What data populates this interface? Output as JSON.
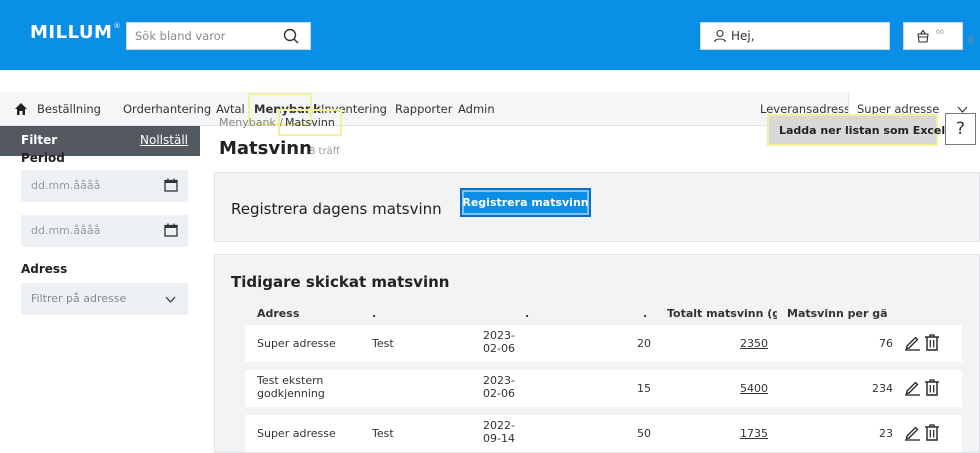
{
  "header": {
    "logo": "MILLUM",
    "logo_mark": "®",
    "search_placeholder": "Sök bland varor",
    "user_label": "Hej,",
    "cart_amount": "0",
    "cart_cents": "00"
  },
  "nav": {
    "items": [
      "Beställning",
      "Orderhantering",
      "Avtal",
      "Menybank",
      "Inventering",
      "Rapporter",
      "Admin"
    ],
    "active": "Menybank",
    "delivery_label": "Leveransadress:",
    "delivery_value": "Super adresse"
  },
  "sidebar": {
    "title": "Filter",
    "reset": "Nollställ",
    "period_label": "Period",
    "date_from_placeholder": "dd.mm.åååå",
    "date_to_placeholder": "dd.mm.åååå",
    "address_label": "Adress",
    "address_placeholder": "Filtrer på adresse"
  },
  "main": {
    "breadcrumb_parent": "Menybank",
    "breadcrumb_sep": "/",
    "breadcrumb_current": "Matsvinn",
    "title": "Matsvinn",
    "count": "8 träff",
    "excel_button": "Ladda ner listan som Excelfil",
    "help": "?",
    "register_title": "Registrera dagens matsvinn",
    "register_button": "Registrera matsvinn",
    "history_title": "Tidigare skickat matsvinn",
    "columns": [
      "Adress",
      ".",
      ".",
      ".",
      "Totalt matsvinn (gra",
      "Matsvinn per gäst (("
    ],
    "rows": [
      {
        "address": "Super adresse",
        "address2": "",
        "name": "Test",
        "date1": "2023-",
        "date2": "02-06",
        "qty": "20",
        "total": "2350",
        "per_guest": "76"
      },
      {
        "address": "Test ekstern",
        "address2": "godkjenning",
        "name": "",
        "date1": "2023-",
        "date2": "02-06",
        "qty": "15",
        "total": "5400",
        "per_guest": "234"
      },
      {
        "address": "Super adresse",
        "address2": "",
        "name": "Test",
        "date1": "2022-",
        "date2": "09-14",
        "qty": "50",
        "total": "1735",
        "per_guest": "23"
      }
    ]
  },
  "colors": {
    "brand_blue": "#0a8fe6",
    "filter_header": "#54595f",
    "highlight": "#f3ef9b"
  }
}
